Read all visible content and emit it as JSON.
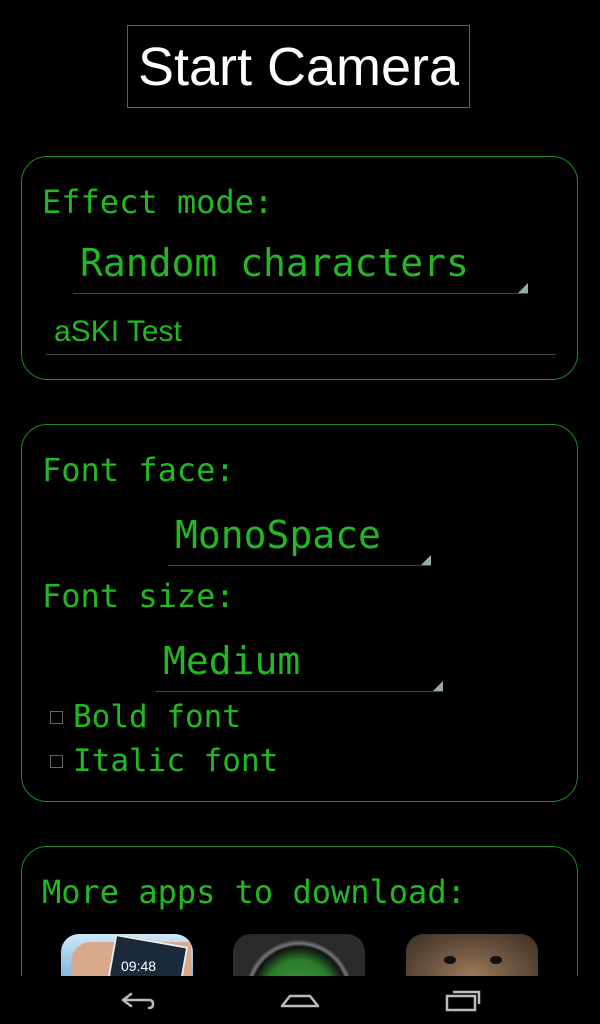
{
  "start_button": {
    "label": "Start Camera"
  },
  "effect_panel": {
    "heading": "Effect mode:",
    "mode_value": "Random characters",
    "text_value": "aSKI Test"
  },
  "font_panel": {
    "face_label": "Font face:",
    "face_value": "MonoSpace",
    "size_label": "Font size:",
    "size_value": "Medium",
    "bold_label": "Bold font",
    "italic_label": "Italic font"
  },
  "apps_panel": {
    "heading": "More apps to download:",
    "apps": [
      {
        "icon": "phone-clock-app-icon",
        "clock_text": "09:48"
      },
      {
        "icon": "green-camera-app-icon"
      },
      {
        "icon": "dog-face-app-icon"
      }
    ]
  },
  "navbar": {
    "icons": [
      "back-icon",
      "home-icon",
      "recent-apps-icon"
    ]
  },
  "colors": {
    "background": "#000000",
    "accent_green": "#22b822",
    "button_border": "#c0392b"
  }
}
